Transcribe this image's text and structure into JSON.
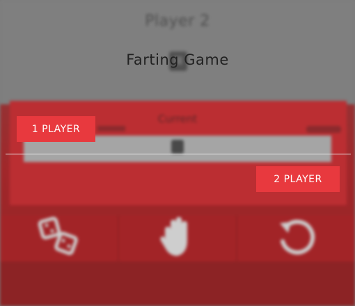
{
  "game": {
    "title": "Farting Game",
    "player_label": "Player 2",
    "current_label": "Current"
  },
  "mode_select": {
    "one_player_label": "1 PLAYER",
    "two_player_label": "2 PLAYER"
  },
  "actions": [
    {
      "name": "roll-dice",
      "icon": "dice-icon"
    },
    {
      "name": "hold",
      "icon": "hand-icon"
    },
    {
      "name": "restart",
      "icon": "restart-icon"
    }
  ],
  "colors": {
    "accent": "#e8393e",
    "board_red": "#a81b1f",
    "overlay_gray": "#7d7d7d"
  }
}
